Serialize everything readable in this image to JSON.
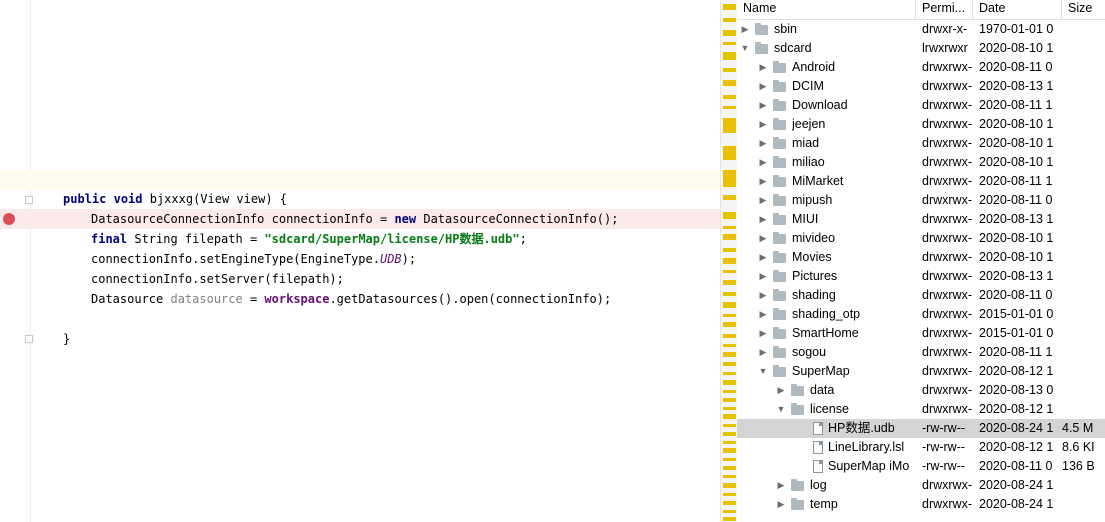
{
  "editor": {
    "lines": {
      "signature": {
        "kw1": "public",
        "kw2": "void",
        "rest": " bjxxxg(View view) {"
      },
      "line1": {
        "a": "DatasourceConnectionInfo connectionInfo = ",
        "kw": "new",
        "b": " DatasourceConnectionInfo();"
      },
      "line2": {
        "kw": "final",
        "a": " String filepath = ",
        "str": "\"sdcard/SuperMap/license/HP数据.udb\"",
        "b": ";"
      },
      "line3": {
        "a": "connectionInfo.setEngineType(EngineType.",
        "static": "UDB",
        "b": ");"
      },
      "line4": {
        "a": "connectionInfo.setServer(filepath);"
      },
      "line5": {
        "a": "Datasource ",
        "unused": "datasource",
        "b": " = ",
        "field": "workspace",
        "c": ".getDatasources().open(connectionInfo);"
      },
      "close": {
        "a": "}"
      }
    },
    "breakpoint_color": "#dc4e57"
  },
  "tree": {
    "headers": {
      "name": "Name",
      "perm": "Permi...",
      "date": "Date",
      "size": "Size"
    },
    "rows": [
      {
        "name": "sbin",
        "perm": "drwxr-x-",
        "date": "1970-01-01 0",
        "size": "",
        "type": "folder",
        "level": 0,
        "arrow": "▶"
      },
      {
        "name": "sdcard",
        "perm": "lrwxrwxr",
        "date": "2020-08-10 1",
        "size": "",
        "type": "folder-link",
        "level": 0,
        "arrow": "▼"
      },
      {
        "name": "Android",
        "perm": "drwxrwx-",
        "date": "2020-08-11 0",
        "size": "",
        "type": "folder",
        "level": 1,
        "arrow": "▶"
      },
      {
        "name": "DCIM",
        "perm": "drwxrwx-",
        "date": "2020-08-13 1",
        "size": "",
        "type": "folder",
        "level": 1,
        "arrow": "▶"
      },
      {
        "name": "Download",
        "perm": "drwxrwx-",
        "date": "2020-08-11 1",
        "size": "",
        "type": "folder",
        "level": 1,
        "arrow": "▶"
      },
      {
        "name": "jeejen",
        "perm": "drwxrwx-",
        "date": "2020-08-10 1",
        "size": "",
        "type": "folder",
        "level": 1,
        "arrow": "▶"
      },
      {
        "name": "miad",
        "perm": "drwxrwx-",
        "date": "2020-08-10 1",
        "size": "",
        "type": "folder",
        "level": 1,
        "arrow": "▶"
      },
      {
        "name": "miliao",
        "perm": "drwxrwx-",
        "date": "2020-08-10 1",
        "size": "",
        "type": "folder",
        "level": 1,
        "arrow": "▶"
      },
      {
        "name": "MiMarket",
        "perm": "drwxrwx-",
        "date": "2020-08-11 1",
        "size": "",
        "type": "folder",
        "level": 1,
        "arrow": "▶"
      },
      {
        "name": "mipush",
        "perm": "drwxrwx-",
        "date": "2020-08-11 0",
        "size": "",
        "type": "folder",
        "level": 1,
        "arrow": "▶"
      },
      {
        "name": "MIUI",
        "perm": "drwxrwx-",
        "date": "2020-08-13 1",
        "size": "",
        "type": "folder",
        "level": 1,
        "arrow": "▶"
      },
      {
        "name": "mivideo",
        "perm": "drwxrwx-",
        "date": "2020-08-10 1",
        "size": "",
        "type": "folder",
        "level": 1,
        "arrow": "▶"
      },
      {
        "name": "Movies",
        "perm": "drwxrwx-",
        "date": "2020-08-10 1",
        "size": "",
        "type": "folder",
        "level": 1,
        "arrow": "▶"
      },
      {
        "name": "Pictures",
        "perm": "drwxrwx-",
        "date": "2020-08-13 1",
        "size": "",
        "type": "folder",
        "level": 1,
        "arrow": "▶"
      },
      {
        "name": "shading",
        "perm": "drwxrwx-",
        "date": "2020-08-11 0",
        "size": "",
        "type": "folder",
        "level": 1,
        "arrow": "▶"
      },
      {
        "name": "shading_otp",
        "perm": "drwxrwx-",
        "date": "2015-01-01 0",
        "size": "",
        "type": "folder",
        "level": 1,
        "arrow": "▶"
      },
      {
        "name": "SmartHome",
        "perm": "drwxrwx-",
        "date": "2015-01-01 0",
        "size": "",
        "type": "folder",
        "level": 1,
        "arrow": "▶"
      },
      {
        "name": "sogou",
        "perm": "drwxrwx-",
        "date": "2020-08-11 1",
        "size": "",
        "type": "folder",
        "level": 1,
        "arrow": "▶"
      },
      {
        "name": "SuperMap",
        "perm": "drwxrwx-",
        "date": "2020-08-12 1",
        "size": "",
        "type": "folder",
        "level": 1,
        "arrow": "▼"
      },
      {
        "name": "data",
        "perm": "drwxrwx-",
        "date": "2020-08-13 0",
        "size": "",
        "type": "folder",
        "level": 2,
        "arrow": "▶"
      },
      {
        "name": "license",
        "perm": "drwxrwx-",
        "date": "2020-08-12 1",
        "size": "",
        "type": "folder",
        "level": 2,
        "arrow": "▼"
      },
      {
        "name": "HP数据.udb",
        "perm": "-rw-rw--",
        "date": "2020-08-24 1",
        "size": "4.5 M",
        "type": "file",
        "level": 3,
        "arrow": "",
        "selected": true
      },
      {
        "name": "LineLibrary.lsl",
        "perm": "-rw-rw--",
        "date": "2020-08-12 1",
        "size": "8.6 KI",
        "type": "file",
        "level": 3,
        "arrow": ""
      },
      {
        "name": "SuperMap iMo",
        "perm": "-rw-rw--",
        "date": "2020-08-11 0",
        "size": "136 B",
        "type": "file",
        "level": 3,
        "arrow": ""
      },
      {
        "name": "log",
        "perm": "drwxrwx-",
        "date": "2020-08-24 1",
        "size": "",
        "type": "folder",
        "level": 2,
        "arrow": "▶"
      },
      {
        "name": "temp",
        "perm": "drwxrwx-",
        "date": "2020-08-24 1",
        "size": "",
        "type": "folder",
        "level": 2,
        "arrow": "▶"
      }
    ]
  }
}
